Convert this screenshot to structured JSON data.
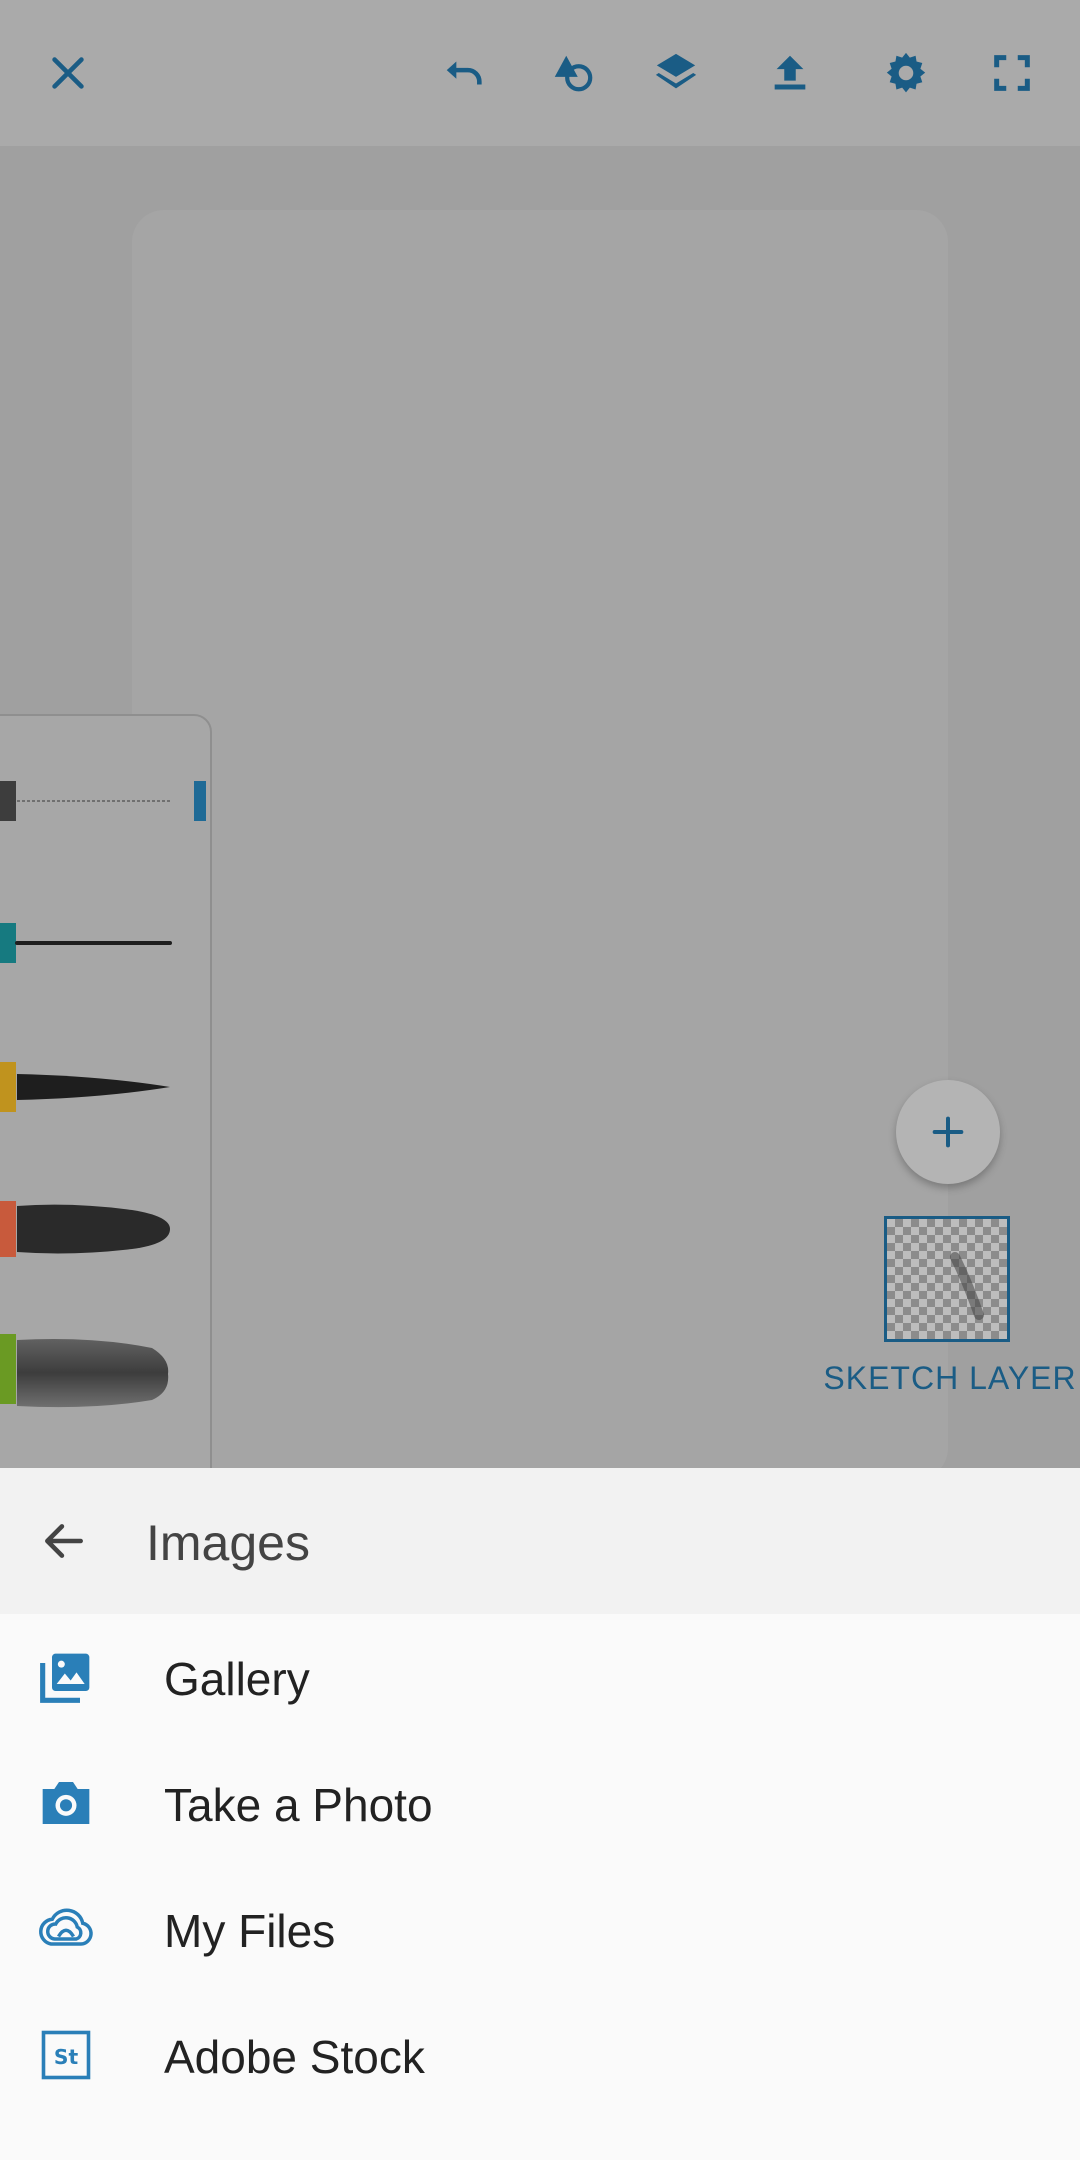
{
  "toolbar": {
    "icons": [
      "close-icon",
      "undo-icon",
      "shapes-icon",
      "layers-icon",
      "share-icon",
      "settings-icon",
      "fullscreen-icon"
    ]
  },
  "brushes": {
    "swatch_colors": [
      "#3d3d3d",
      "#167a80",
      "#c0931e",
      "#c85a3c",
      "#6a9a23",
      "#9a9a9a"
    ]
  },
  "layers": {
    "add_label": "+",
    "current_layer_label": "SKETCH LAYER"
  },
  "sheet": {
    "title": "Images",
    "items": [
      {
        "label": "Gallery",
        "icon": "gallery-icon"
      },
      {
        "label": "Take a Photo",
        "icon": "camera-icon"
      },
      {
        "label": "My Files",
        "icon": "creative-cloud-icon"
      },
      {
        "label": "Adobe Stock",
        "icon": "adobe-stock-icon"
      }
    ]
  },
  "colors": {
    "accent": "#1a5c85",
    "icon_blue": "#2a7fb8"
  }
}
